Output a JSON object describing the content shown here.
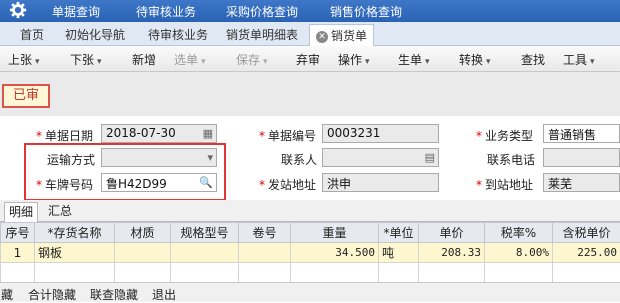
{
  "topmenu": [
    "单据查询",
    "待审核业务",
    "采购价格查询",
    "销售价格查询"
  ],
  "tabs": [
    "首页",
    "初始化导航",
    "待审核业务",
    "销货单明细表",
    "销货单"
  ],
  "toolbar": {
    "items": [
      {
        "label": "上张",
        "dropdown": true,
        "disabled": false
      },
      {
        "label": "下张",
        "dropdown": true,
        "disabled": false
      },
      {
        "label": "新增",
        "dropdown": false,
        "disabled": false
      },
      {
        "label": "选单",
        "dropdown": true,
        "disabled": true
      },
      {
        "label": "保存",
        "dropdown": true,
        "disabled": true
      },
      {
        "label": "弃审",
        "dropdown": false,
        "disabled": false
      },
      {
        "label": "操作",
        "dropdown": true,
        "disabled": false
      },
      {
        "label": "生单",
        "dropdown": true,
        "disabled": false
      },
      {
        "label": "转换",
        "dropdown": true,
        "disabled": false
      },
      {
        "label": "查找",
        "dropdown": false,
        "disabled": false
      },
      {
        "label": "工具",
        "dropdown": true,
        "disabled": false
      }
    ],
    "arrow": "▾"
  },
  "status_badge": "已审",
  "form": {
    "doc_date": {
      "label": "单据日期",
      "value": "2018-07-30"
    },
    "doc_no": {
      "label": "单据编号",
      "value": "0003231"
    },
    "biz_type": {
      "label": "业务类型",
      "value": "普通销售"
    },
    "transport": {
      "label": "运输方式",
      "value": ""
    },
    "contact": {
      "label": "联系人",
      "value": ""
    },
    "phone": {
      "label": "联系电话",
      "value": ""
    },
    "plate": {
      "label": "车牌号码",
      "value": "鲁H42D99"
    },
    "from_addr": {
      "label": "发站地址",
      "value": "洪申"
    },
    "to_addr": {
      "label": "到站地址",
      "value": "莱芜"
    }
  },
  "detail_tabs": [
    "明细",
    "汇总"
  ],
  "grid": {
    "headers": [
      "序号",
      "*存货名称",
      "材质",
      "规格型号",
      "卷号",
      "重量",
      "*单位",
      "单价",
      "税率%",
      "含税单价"
    ],
    "rows": [
      {
        "seq": "1",
        "name": "钢板",
        "material": "",
        "spec": "",
        "coil": "",
        "weight": "34.500",
        "unit": "吨",
        "price": "208.33",
        "tax": "8.00%",
        "tax_price": "225.00"
      }
    ]
  },
  "bottom": [
    "藏",
    "合计隐藏",
    "联查隐藏",
    "退出"
  ],
  "colors": {
    "accent": "#2a62b4",
    "highlight_box": "#e03535",
    "status": "#c0392b"
  }
}
